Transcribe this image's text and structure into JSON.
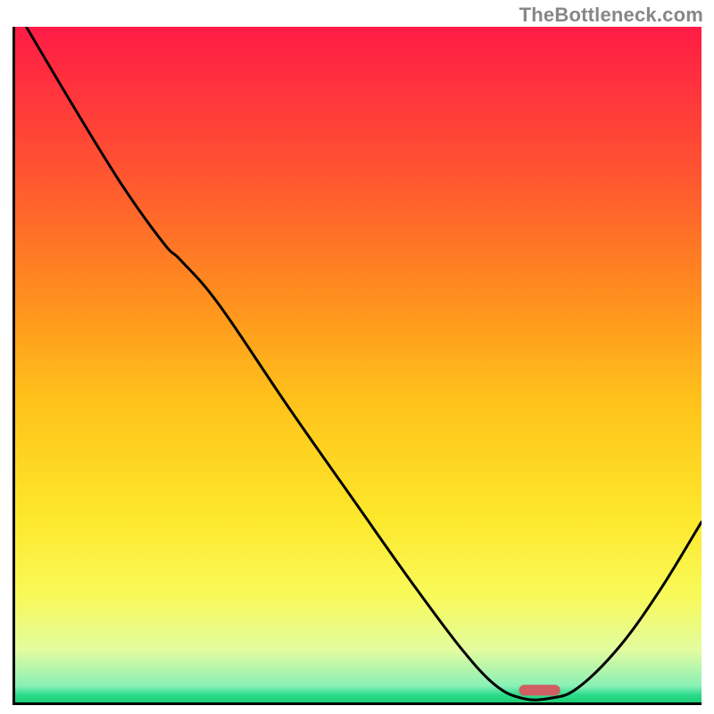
{
  "watermark": "TheBottleneck.com",
  "chart_data": {
    "type": "line",
    "title": "",
    "xlabel": "",
    "ylabel": "",
    "xlim": [
      0,
      100
    ],
    "ylim": [
      0,
      100
    ],
    "grid": false,
    "legend": false,
    "background_gradient_stops": [
      {
        "offset": 0.0,
        "color": "#ff1b46"
      },
      {
        "offset": 0.2,
        "color": "#ff5032"
      },
      {
        "offset": 0.4,
        "color": "#ff8f1e"
      },
      {
        "offset": 0.55,
        "color": "#ffc21a"
      },
      {
        "offset": 0.72,
        "color": "#fde72a"
      },
      {
        "offset": 0.84,
        "color": "#f8fa5a"
      },
      {
        "offset": 0.92,
        "color": "#e2fca0"
      },
      {
        "offset": 0.972,
        "color": "#88f0b6"
      },
      {
        "offset": 0.985,
        "color": "#2bdc8a"
      },
      {
        "offset": 1.0,
        "color": "#17c96e"
      }
    ],
    "curve_points_xy_pct": [
      [
        2.0,
        100.0
      ],
      [
        9.0,
        88.0
      ],
      [
        16.0,
        76.5
      ],
      [
        22.0,
        68.0
      ],
      [
        24.5,
        65.5
      ],
      [
        30.0,
        59.0
      ],
      [
        40.0,
        44.0
      ],
      [
        50.0,
        29.5
      ],
      [
        58.0,
        18.0
      ],
      [
        65.0,
        8.5
      ],
      [
        70.0,
        3.0
      ],
      [
        74.0,
        1.0
      ],
      [
        78.0,
        1.0
      ],
      [
        82.0,
        2.5
      ],
      [
        88.0,
        8.5
      ],
      [
        94.0,
        17.0
      ],
      [
        100.0,
        27.0
      ]
    ],
    "marker": {
      "center_x_pct": 76.5,
      "center_y_pct": 2.2,
      "width_pct": 6.0,
      "height_pct": 1.6,
      "color": "#cf5f63",
      "shape": "rounded-pill"
    },
    "axis_stroke": "#000000",
    "axis_stroke_width_px": 3,
    "curve_stroke": "#000000",
    "curve_stroke_width_px": 3
  }
}
